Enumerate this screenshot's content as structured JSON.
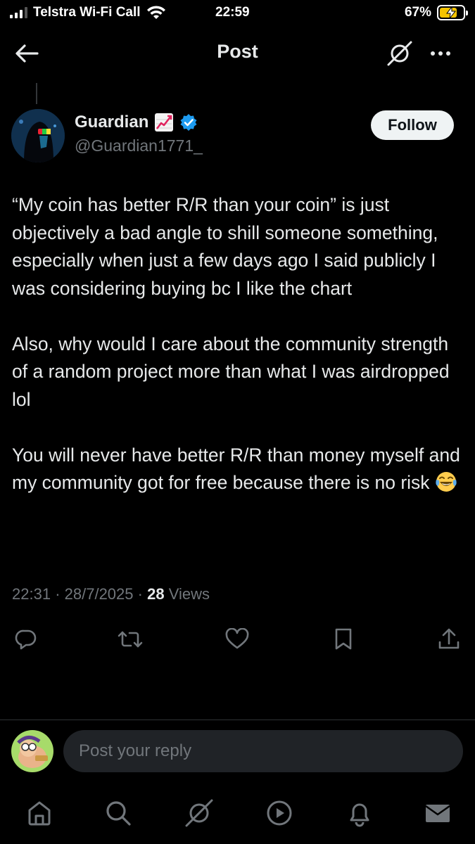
{
  "status_bar": {
    "carrier": "Telstra Wi-Fi Call",
    "time": "22:59",
    "battery": "67%",
    "battery_level": 0.67
  },
  "header": {
    "title": "Post"
  },
  "post": {
    "author": {
      "name": "Guardian",
      "handle": "@Guardian1771_",
      "verified": true,
      "name_emoji": "chart-increasing"
    },
    "follow_label": "Follow",
    "paragraphs": [
      "“My coin has better R/R than your coin” is just objectively a bad angle to shill someone something, especially when just a few days ago I said publicly I was considering buying bc I like the chart",
      "Also, why would I care about the community strength of a random project more than what I was airdropped lol",
      "You will never have better R/R than money myself and my community got for free because there is no risk"
    ],
    "trailing_emoji": "face-with-tears-of-joy",
    "time": "22:31",
    "date": "28/7/2025",
    "views_count": "28",
    "views_label": "Views",
    "separator": "·"
  },
  "actions": [
    "reply-icon",
    "repost-icon",
    "like-icon",
    "bookmark-icon",
    "share-icon"
  ],
  "reply": {
    "placeholder": "Post your reply"
  },
  "bottom_nav": [
    "home-icon",
    "search-icon",
    "grok-icon",
    "video-icon",
    "notifications-icon",
    "messages-icon"
  ],
  "colors": {
    "background": "#000000",
    "text": "#e7e9ea",
    "muted": "#71767b",
    "verified": "#1d9bf0",
    "follow_bg": "#eff3f4"
  }
}
